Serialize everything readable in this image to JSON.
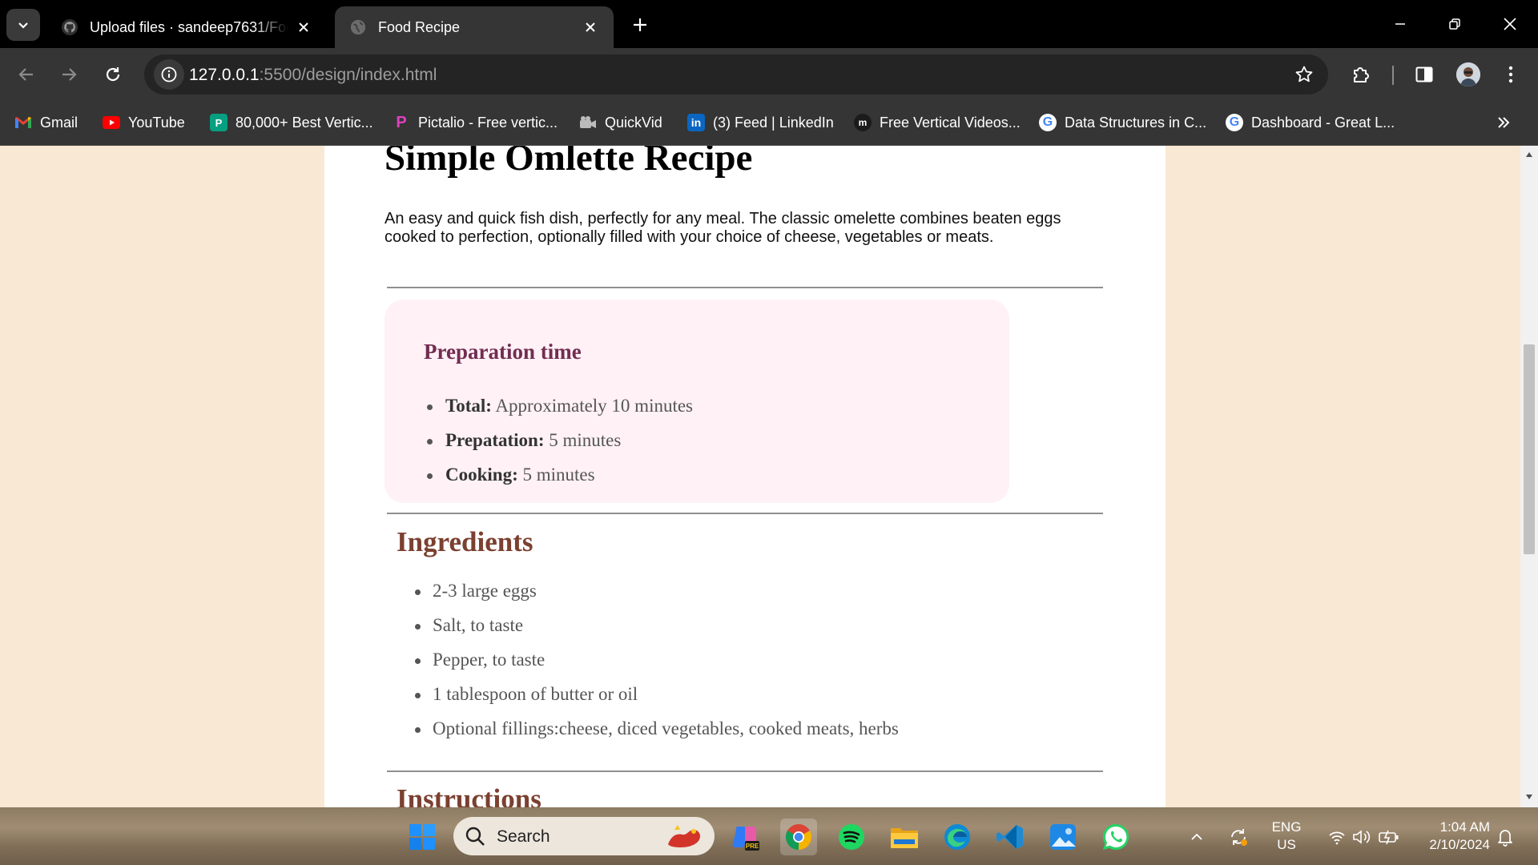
{
  "browser": {
    "tabs": [
      {
        "title": "Upload files · sandeep7631/Food-Recipe",
        "icon": "github-icon",
        "active": false
      },
      {
        "title": "Food Recipe",
        "icon": "globe-icon",
        "active": true
      }
    ],
    "url_host": "127.0.0.1",
    "url_path": ":5500/design/index.html",
    "bookmarks": [
      {
        "label": "Gmail",
        "icon": "gmail-icon"
      },
      {
        "label": "YouTube",
        "icon": "youtube-icon"
      },
      {
        "label": "80,000+ Best Vertic...",
        "icon": "pexels-icon"
      },
      {
        "label": "Pictalio - Free vertic...",
        "icon": "pictalio-icon"
      },
      {
        "label": "QuickVid",
        "icon": "quickvid-icon"
      },
      {
        "label": "(3) Feed | LinkedIn",
        "icon": "linkedin-icon"
      },
      {
        "label": "Free Vertical Videos...",
        "icon": "mixkit-icon"
      },
      {
        "label": "Data Structures in C...",
        "icon": "google-icon"
      },
      {
        "label": "Dashboard - Great L...",
        "icon": "google-icon"
      }
    ]
  },
  "recipe": {
    "title": "Simple Omlette Recipe",
    "description": "An easy and quick fish dish, perfectly for any meal. The classic omelette combines beaten eggs cooked to perfection, optionally filled with your choice of cheese, vegetables or meats.",
    "prep": {
      "heading": "Preparation time",
      "items": [
        {
          "label": "Total:",
          "value": " Approximately 10 minutes"
        },
        {
          "label": "Prepatation:",
          "value": " 5 minutes"
        },
        {
          "label": "Cooking:",
          "value": " 5 minutes"
        }
      ]
    },
    "ingredients_heading": "Ingredients",
    "ingredients": [
      "2-3 large eggs",
      "Salt, to taste",
      "Pepper, to taste",
      "1 tablespoon of butter or oil",
      "Optional fillings:cheese, diced vegetables, cooked meats, herbs"
    ],
    "instructions_heading": "Instructions"
  },
  "colors": {
    "page_bg": "#f8e8d4",
    "prep_bg": "#fff1f5",
    "prep_title": "#722d52",
    "section_title": "#7b4030"
  },
  "taskbar": {
    "search_placeholder": "Search",
    "lang_top": "ENG",
    "lang_bottom": "US",
    "time": "1:04 AM",
    "date": "2/10/2024",
    "apps": [
      "windows-start-icon",
      "copilot-icon",
      "chrome-icon",
      "spotify-icon",
      "file-explorer-icon",
      "edge-icon",
      "vscode-icon",
      "photos-icon",
      "whatsapp-icon"
    ]
  }
}
